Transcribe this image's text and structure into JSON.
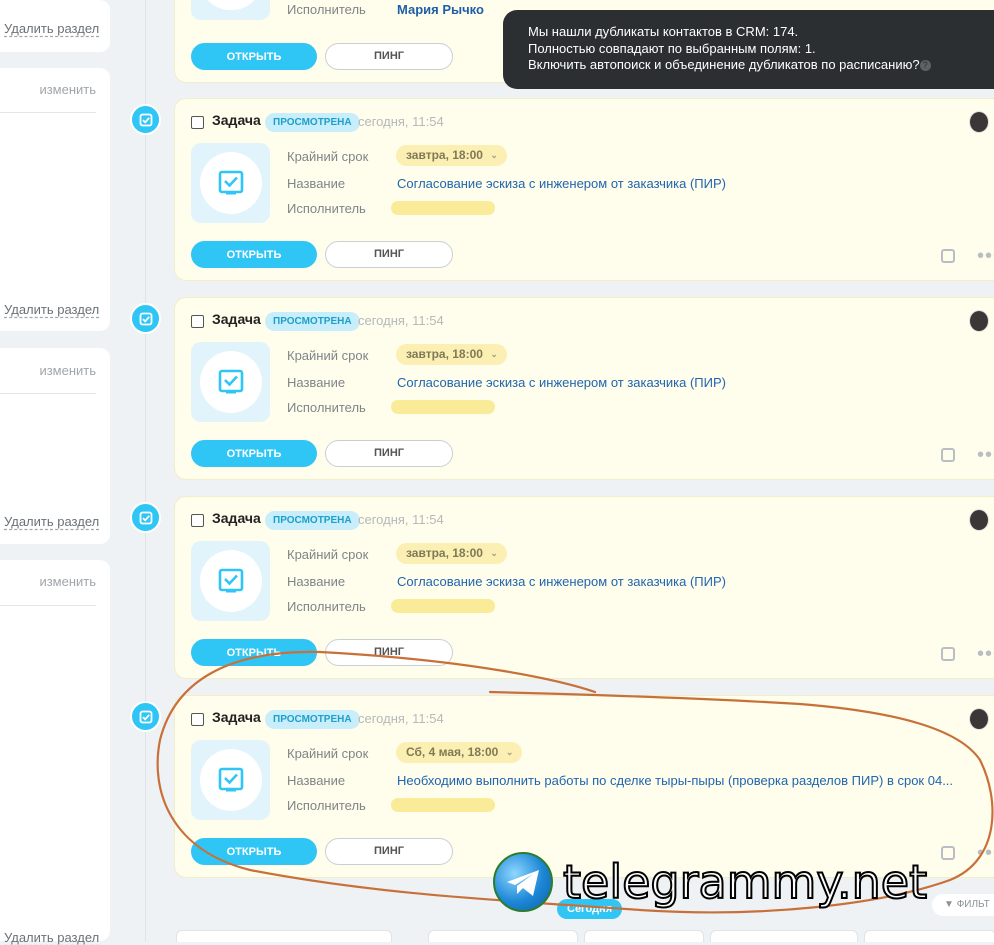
{
  "sidebar": {
    "delete_section_label": "Удалить раздел",
    "edit_label": "изменить"
  },
  "notification": {
    "line1": "Мы нашли дубликаты контактов в CRM: 174.",
    "line2": "Полностью совпадают по выбранным полям: 1.",
    "line3": "Включить автопоиск и объединение дубликатов по расписанию?",
    "help_glyph": "?"
  },
  "top_card": {
    "executor_label": "Исполнитель",
    "executor_value": "Мария Рычко",
    "open_label": "ОТКРЫТЬ",
    "ping_label": "ПИНГ"
  },
  "cards": [
    {
      "title": "Задача",
      "badge": "ПРОСМОТРЕНА",
      "time": "сегодня, 11:54",
      "deadline_label": "Крайний срок",
      "deadline_value": "завтра, 18:00",
      "name_label": "Название",
      "name_value": "Согласование эскиза с инженером от заказчика (ПИР)",
      "executor_label": "Исполнитель",
      "open_label": "ОТКРЫТЬ",
      "ping_label": "ПИНГ"
    },
    {
      "title": "Задача",
      "badge": "ПРОСМОТРЕНА",
      "time": "сегодня, 11:54",
      "deadline_label": "Крайний срок",
      "deadline_value": "завтра, 18:00",
      "name_label": "Название",
      "name_value": "Согласование эскиза с инженером от заказчика (ПИР)",
      "executor_label": "Исполнитель",
      "open_label": "ОТКРЫТЬ",
      "ping_label": "ПИНГ"
    },
    {
      "title": "Задача",
      "badge": "ПРОСМОТРЕНА",
      "time": "сегодня, 11:54",
      "deadline_label": "Крайний срок",
      "deadline_value": "завтра, 18:00",
      "name_label": "Название",
      "name_value": "Согласование эскиза с инженером от заказчика (ПИР)",
      "executor_label": "Исполнитель",
      "open_label": "ОТКРЫТЬ",
      "ping_label": "ПИНГ"
    },
    {
      "title": "Задача",
      "badge": "ПРОСМОТРЕНА",
      "time": "сегодня, 11:54",
      "deadline_label": "Крайний срок",
      "deadline_value": "Сб, 4 мая, 18:00",
      "name_label": "Название",
      "name_value": "Необходимо выполнить работы по сделке тыры-пыры (проверка разделов ПИР) в срок 04...",
      "executor_label": "Исполнитель",
      "open_label": "ОТКРЫТЬ",
      "ping_label": "ПИНГ"
    }
  ],
  "footer": {
    "today_label": "Сегодня",
    "filter_label": "ФИЛЬТ",
    "watermark": "telegrammy.net"
  },
  "colors": {
    "accent": "#2fc6f6",
    "card_bg": "#fffdeb",
    "link": "#2066b0",
    "annotation": "#c8703a"
  }
}
